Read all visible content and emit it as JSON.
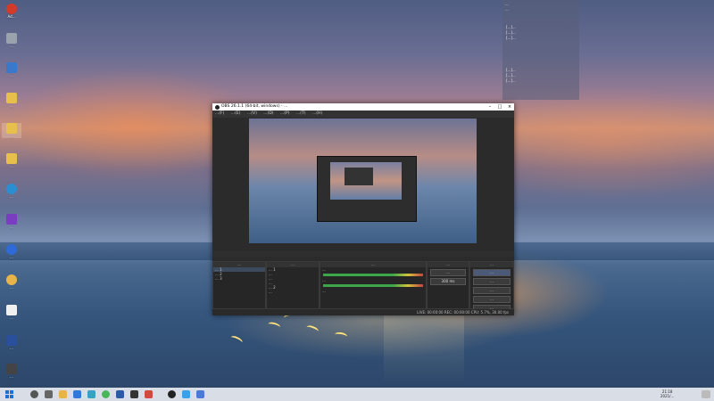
{
  "desktop": {
    "icons": [
      {
        "label": "Ad...",
        "color": "#d23a2a"
      },
      {
        "label": "...",
        "color": "#9aa3ad"
      },
      {
        "label": "...",
        "color": "#3a78c9"
      },
      {
        "label": "...",
        "color": "#e6c04a"
      },
      {
        "label": "...",
        "color": "#e6c04a"
      },
      {
        "label": "...",
        "color": "#e6c04a"
      },
      {
        "label": "...",
        "color": "#2a8fd0"
      },
      {
        "label": "...",
        "color": "#7a3cc0"
      },
      {
        "label": "...",
        "color": "#2f6ad6"
      },
      {
        "label": "...",
        "color": "#e8b44a"
      },
      {
        "label": "...",
        "color": "#f0f0f0"
      },
      {
        "label": "...",
        "color": "#2a4f9c"
      },
      {
        "label": "...",
        "color": "#444444"
      }
    ]
  },
  "overlay_panel": {
    "stats": [
      "...",
      "..."
    ],
    "log_top": [
      "[...]...",
      "[...]...",
      "[...]..."
    ],
    "log_bottom": [
      "[...]...",
      "[...]...",
      "[...]..."
    ]
  },
  "obs": {
    "title": "OBS 26.1.1 (64-bit, windows) - ...",
    "menu": [
      "...(F)",
      "...(E)",
      "...(V)",
      "...(D)",
      "...(P)",
      "...(T)",
      "...(H)"
    ],
    "scenes_header": "...",
    "scenes": [
      "... 1",
      "... 2",
      "... 3"
    ],
    "sources_header": "...",
    "sources": [
      "... 1",
      "...",
      "...",
      "...",
      "... 2",
      "..."
    ],
    "mixer_header": "...",
    "mixer_rows": [
      "...",
      "...",
      "..."
    ],
    "transitions_header": "...",
    "transition_type": "...",
    "transition_duration": "300 ms",
    "controls_header": "...",
    "controls": [
      "...",
      "...",
      "...",
      "...",
      "...",
      "..."
    ],
    "status": "LIVE: 00:00:00   REC: 00:00:00   CPU: 5.7%, 30.00 fps"
  },
  "taskbar": {
    "time": "21:18",
    "date": "2021/..."
  }
}
